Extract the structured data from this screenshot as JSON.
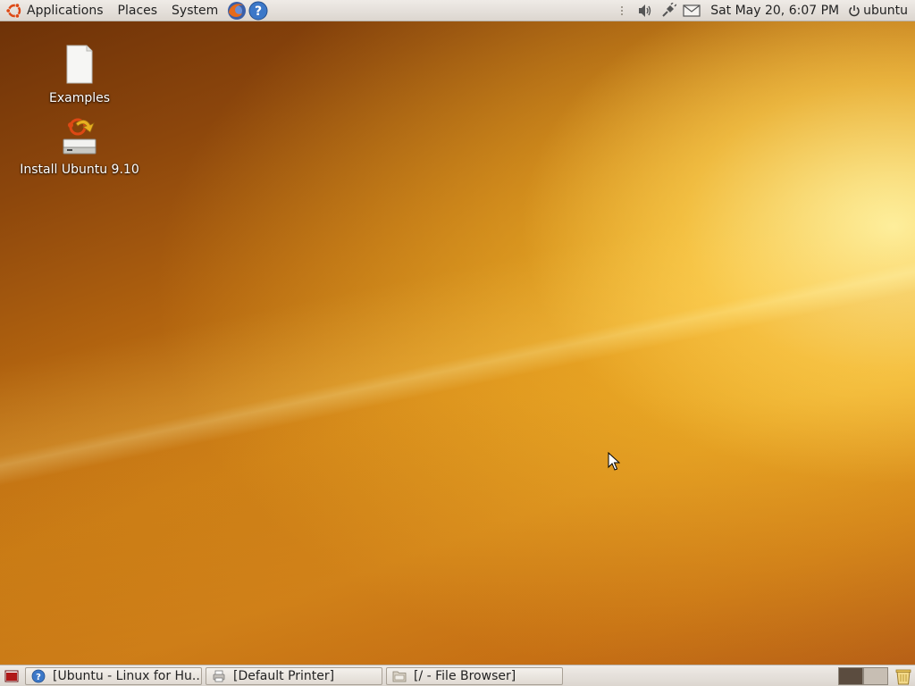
{
  "top_panel": {
    "menus": [
      {
        "label": "Applications",
        "icon": "ubuntu-logo-icon"
      },
      {
        "label": "Places"
      },
      {
        "label": "System"
      }
    ],
    "launchers": [
      "firefox-icon",
      "help-icon"
    ],
    "tray_icons": [
      "volume-icon",
      "network-icon",
      "mail-icon"
    ],
    "clock": "Sat May 20,  6:07 PM",
    "user": "ubuntu"
  },
  "desktop": {
    "icons": [
      {
        "label": "Examples",
        "icon": "document-icon"
      },
      {
        "label": "Install Ubuntu 9.10",
        "icon": "install-icon"
      }
    ]
  },
  "bottom_panel": {
    "tasks": [
      {
        "label": "[Ubuntu - Linux for Hu...",
        "icon": "help-icon"
      },
      {
        "label": "[Default Printer]",
        "icon": "printer-icon"
      },
      {
        "label": "[/ - File Browser]",
        "icon": "folder-icon"
      }
    ],
    "workspaces": [
      {
        "active": true
      },
      {
        "active": false
      }
    ]
  },
  "colors": {
    "panel_bg": "#dcd6cf",
    "wallpaper_dark": "#6e3208",
    "wallpaper_light": "#ffe89a",
    "ubuntu_orange": "#dd4814"
  }
}
